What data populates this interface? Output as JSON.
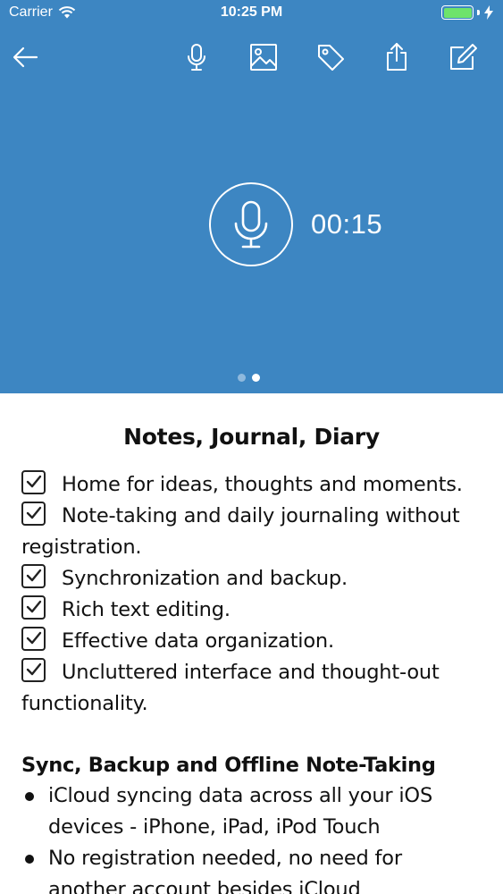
{
  "status_bar": {
    "carrier": "Carrier",
    "time": "10:25 PM"
  },
  "toolbar": {
    "icons": [
      "back-arrow-icon",
      "microphone-icon",
      "image-icon",
      "tag-icon",
      "share-icon",
      "edit-icon"
    ]
  },
  "recorder": {
    "elapsed": "00:15"
  },
  "pager": {
    "count": 2,
    "active_index": 1
  },
  "content": {
    "heading": "Notes, Journal, Diary",
    "features": [
      "Home for ideas, thoughts and moments.",
      "Note-taking and daily journaling without registration.",
      "Synchronization and backup.",
      "Rich text editing.",
      "Effective data organization.",
      "Uncluttered interface and thought-out functionality."
    ],
    "section_title": "Sync, Backup and Offline Note-Taking",
    "sync_points": [
      "iCloud syncing data across all your iOS devices - iPhone, iPad, iPod Touch",
      "No registration needed, no need for another account besides iCloud"
    ]
  },
  "colors": {
    "hero_background": "#3d86c2",
    "battery": "#6ee36b"
  }
}
